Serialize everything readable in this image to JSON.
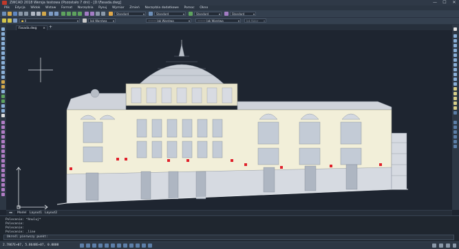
{
  "titlebar": {
    "title": "ZWCAD 2018 Wersja testowa (Pozostało 7 dni) - [D:\\Fasada.dwg]",
    "minimize": "—",
    "maximize": "☐",
    "close": "✕"
  },
  "menu": [
    "Plik",
    "Edycja",
    "Widok",
    "Wstaw",
    "Format",
    "Narzędzia",
    "Rysuj",
    "Wymiar",
    "Zmień",
    "Narzędzia dodatkowe",
    "Pomoc",
    "Okno"
  ],
  "toolbar": {
    "text_style": "Standard",
    "dim_style": "Standard",
    "table_style": "Standard",
    "multileader_style": "Standard",
    "layer": "Jak Warstwa",
    "linetype": "Jak Warstwa",
    "lineweight": "Jak Warstwa",
    "plot_style": "Jak Kolor",
    "layer_name": "0"
  },
  "tabs": {
    "file_tab": "Fasada.dwg",
    "file_tab_close": "×",
    "add_tab": "+"
  },
  "layout_tabs": [
    "Model",
    "Layout1",
    "Layout2"
  ],
  "command": {
    "history": [
      "Polecenie: *Anuluj*",
      "Polecenie:",
      "Polecenie:",
      "Polecenie: _line"
    ],
    "prompt": "Określ pierwszy punkt:"
  },
  "status": {
    "coordinates": "2.7867E+07, 5.8648E+07, 0.0000"
  },
  "colors": {
    "canvas": "#1e2530",
    "facade": "#f2efd9",
    "roof": "#c9ced6",
    "glass": "#c3cbd6",
    "accent_red": "#e0202a"
  },
  "icons": {
    "crosshair": "crosshair-icon",
    "ucs": "ucs-icon",
    "app": "zwcad-logo-icon"
  }
}
